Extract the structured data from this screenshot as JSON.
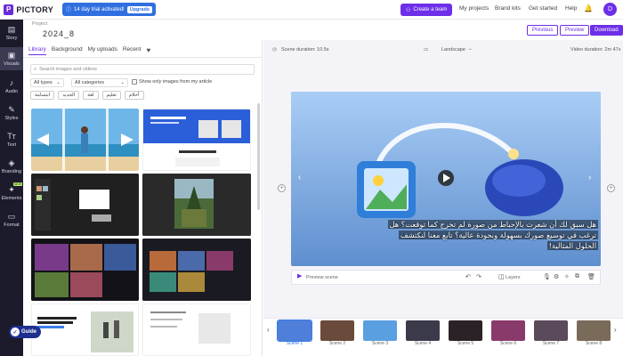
{
  "header": {
    "logo_text": "PICTORY",
    "trial_text": "14 day trial activated!",
    "upgrade_label": "Upgrade",
    "create_team_label": "Create a team",
    "nav": [
      "My projects",
      "Brand kits",
      "Get started",
      "Help"
    ],
    "avatar_initial": "D"
  },
  "sidebar": {
    "items": [
      {
        "label": "Story",
        "icon": "story-icon"
      },
      {
        "label": "Visuals",
        "icon": "visuals-icon"
      },
      {
        "label": "Audio",
        "icon": "audio-icon"
      },
      {
        "label": "Styles",
        "icon": "styles-icon"
      },
      {
        "label": "Text",
        "icon": "text-icon"
      },
      {
        "label": "Branding",
        "icon": "branding-icon"
      },
      {
        "label": "Elements",
        "icon": "elements-icon",
        "badge": "NEW"
      },
      {
        "label": "Format",
        "icon": "format-icon"
      }
    ]
  },
  "project": {
    "label": "Project",
    "name": "2024_8",
    "buttons": {
      "previous": "Previous",
      "preview": "Preview",
      "download": "Download"
    }
  },
  "panel": {
    "tabs": [
      "Library",
      "Background",
      "My uploads",
      "Recent"
    ],
    "search_placeholder": "Search images and videos",
    "filter_type": "All types",
    "filter_category": "All categories",
    "only_images_label": "Show only images from my article",
    "chips": [
      "ابتسامة",
      "الجديد",
      "لغة",
      "تعليم",
      "أحلام"
    ]
  },
  "editor": {
    "scene_duration": "Scene duration: 10.5s",
    "orientation": "Landscape",
    "video_duration": "Video duration: 2m 47s",
    "caption_lines": [
      "هل سبق لك أن شعرت بالإحباط من صورة لم تخرج كما توقعت؟ هل",
      "ترغب في توسيع صورك بسهولة وبجودة عالية؟ تابع معنا لنكتشف",
      "الحلول المثالية!"
    ],
    "preview_scene_label": "Preview scene",
    "layers_label": "Layers"
  },
  "timeline": {
    "scenes": [
      "Scene 1",
      "Scene 2",
      "Scene 3",
      "Scene 4",
      "Scene 5",
      "Scene 6",
      "Scene 7",
      "Scene 8"
    ]
  },
  "guide_label": "Guide",
  "colors": {
    "accent": "#6d2fe8",
    "sidebar": "#1b1b2b",
    "trial": "#2f6fe0"
  }
}
